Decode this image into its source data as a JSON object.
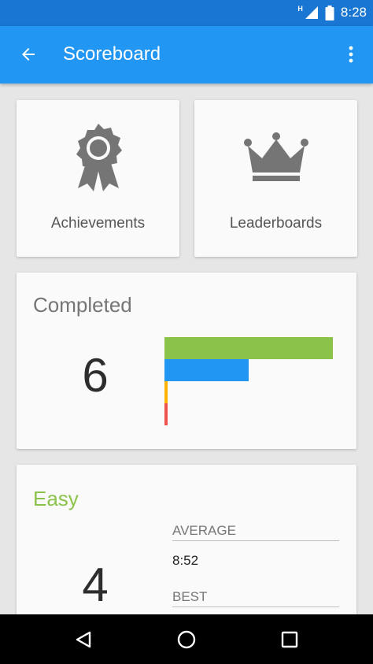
{
  "status_bar": {
    "network_type": "H",
    "time": "8:28",
    "icons": [
      "signal-icon",
      "battery-icon"
    ]
  },
  "app_bar": {
    "title": "Scoreboard",
    "back_icon": "arrow-left-icon",
    "menu_icon": "more-vert-icon"
  },
  "tiles": [
    {
      "label": "Achievements",
      "icon": "award-ribbon-icon"
    },
    {
      "label": "Leaderboards",
      "icon": "crown-icon"
    }
  ],
  "completed": {
    "heading": "Completed",
    "value": "6",
    "bars": [
      {
        "value": 4,
        "color": "#8bc34a"
      },
      {
        "value": 2,
        "color": "#2196f3"
      },
      {
        "value": 0,
        "color": "#ffb300"
      },
      {
        "value": 0,
        "color": "#ef5350"
      }
    ]
  },
  "easy": {
    "heading": "Easy",
    "value": "4",
    "average_label": "AVERAGE",
    "average_value": "8:52",
    "best_label": "BEST"
  },
  "nav_bar": {
    "icons": [
      "back-triangle-icon",
      "home-circle-icon",
      "recents-square-icon"
    ]
  },
  "colors": {
    "primary": "#2196f3",
    "primary_dark": "#1976d2",
    "easy_accent": "#8bc34a"
  }
}
